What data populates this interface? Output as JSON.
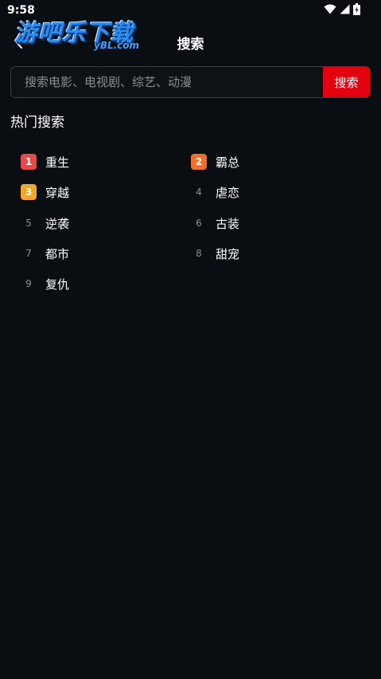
{
  "status_bar": {
    "time": "9:58",
    "icons": [
      "wifi-icon",
      "signal-icon",
      "battery-icon"
    ]
  },
  "watermark": {
    "main": "游吧乐下载",
    "sub": "yBL.com"
  },
  "header": {
    "back_icon": "chevron-left-icon",
    "title": "搜索"
  },
  "search": {
    "placeholder": "搜索电影、电视剧、综艺、动漫",
    "value": "",
    "button_label": "搜索"
  },
  "hot_search": {
    "title": "热门搜索",
    "items": [
      {
        "rank": "1",
        "label": "重生",
        "badge_color": "#e84a4a"
      },
      {
        "rank": "2",
        "label": "霸总",
        "badge_color": "#f0702a"
      },
      {
        "rank": "3",
        "label": "穿越",
        "badge_color": "#f5a626"
      },
      {
        "rank": "4",
        "label": "虐恋"
      },
      {
        "rank": "5",
        "label": "逆袭"
      },
      {
        "rank": "6",
        "label": "古装"
      },
      {
        "rank": "7",
        "label": "都市"
      },
      {
        "rank": "8",
        "label": "甜宠"
      },
      {
        "rank": "9",
        "label": "复仇"
      }
    ]
  },
  "colors": {
    "background": "#0a0d11",
    "accent_red": "#e3000f",
    "muted_text": "#8b8e93"
  }
}
